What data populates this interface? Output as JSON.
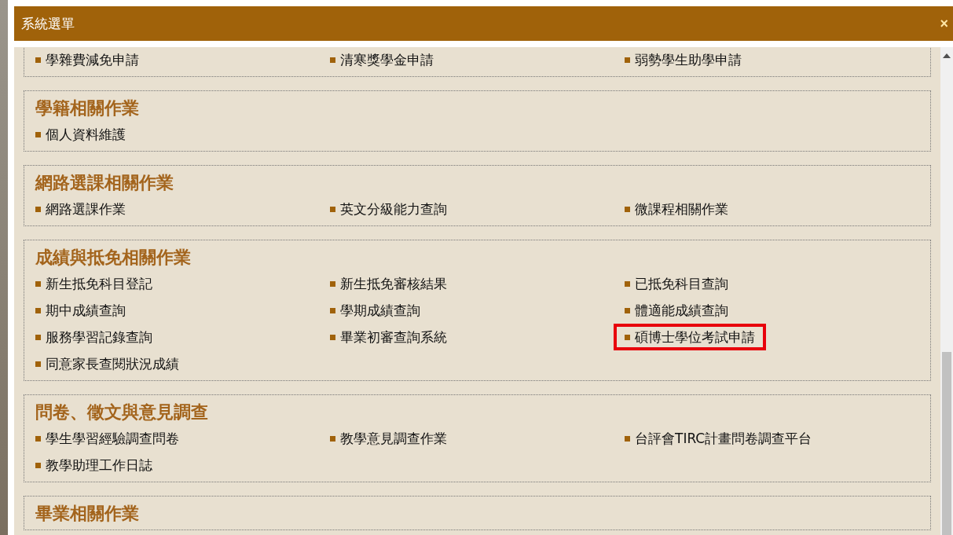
{
  "window": {
    "title": "系統選單",
    "close": "×"
  },
  "sections": [
    {
      "items": [
        {
          "label": "學雜費減免申請",
          "highlighted": false
        },
        {
          "label": "清寒獎學金申請",
          "highlighted": false
        },
        {
          "label": "弱勢學生助學申請",
          "highlighted": false
        }
      ]
    },
    {
      "title": "學籍相關作業",
      "items": [
        {
          "label": "個人資料維護",
          "highlighted": false
        }
      ]
    },
    {
      "title": "網路選課相關作業",
      "items": [
        {
          "label": "網路選課作業",
          "highlighted": false
        },
        {
          "label": "英文分級能力查詢",
          "highlighted": false
        },
        {
          "label": "微課程相關作業",
          "highlighted": false
        }
      ]
    },
    {
      "title": "成績與抵免相關作業",
      "items": [
        {
          "label": "新生抵免科目登記",
          "highlighted": false
        },
        {
          "label": "新生抵免審核結果",
          "highlighted": false
        },
        {
          "label": "已抵免科目查詢",
          "highlighted": false
        },
        {
          "label": "期中成績查詢",
          "highlighted": false
        },
        {
          "label": "學期成績查詢",
          "highlighted": false
        },
        {
          "label": "體適能成績查詢",
          "highlighted": false
        },
        {
          "label": "服務學習記錄查詢",
          "highlighted": false
        },
        {
          "label": "畢業初審查詢系統",
          "highlighted": false
        },
        {
          "label": "碩博士學位考試申請",
          "highlighted": true
        },
        {
          "label": "同意家長查閱狀況成績",
          "highlighted": false
        }
      ]
    },
    {
      "title": "問卷、徵文與意見調查",
      "items": [
        {
          "label": "學生學習經驗調查問卷",
          "highlighted": false
        },
        {
          "label": "教學意見調查作業",
          "highlighted": false
        },
        {
          "label": "台評會TIRC計畫問卷調查平台",
          "highlighted": false
        },
        {
          "label": "教學助理工作日誌",
          "highlighted": false
        }
      ]
    },
    {
      "title": "畢業相關作業"
    }
  ]
}
